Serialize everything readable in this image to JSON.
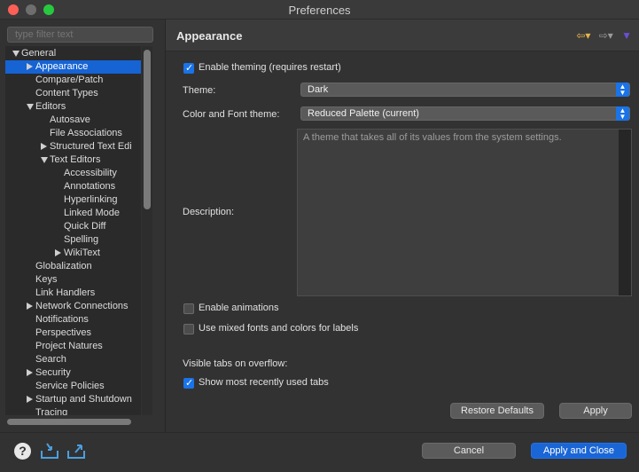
{
  "window": {
    "title": "Preferences"
  },
  "filter": {
    "placeholder": "type filter text"
  },
  "tree": {
    "items": [
      {
        "label": "General",
        "level": 0,
        "expander": "down",
        "selected": false
      },
      {
        "label": "Appearance",
        "level": 1,
        "expander": "right",
        "selected": true
      },
      {
        "label": "Compare/Patch",
        "level": 1,
        "expander": "",
        "selected": false
      },
      {
        "label": "Content Types",
        "level": 1,
        "expander": "",
        "selected": false
      },
      {
        "label": "Editors",
        "level": 1,
        "expander": "down",
        "selected": false
      },
      {
        "label": "Autosave",
        "level": 2,
        "expander": "",
        "selected": false
      },
      {
        "label": "File Associations",
        "level": 2,
        "expander": "",
        "selected": false
      },
      {
        "label": "Structured Text Edi",
        "level": 2,
        "expander": "right",
        "selected": false
      },
      {
        "label": "Text Editors",
        "level": 2,
        "expander": "down",
        "selected": false
      },
      {
        "label": "Accessibility",
        "level": 3,
        "expander": "",
        "selected": false
      },
      {
        "label": "Annotations",
        "level": 3,
        "expander": "",
        "selected": false
      },
      {
        "label": "Hyperlinking",
        "level": 3,
        "expander": "",
        "selected": false
      },
      {
        "label": "Linked Mode",
        "level": 3,
        "expander": "",
        "selected": false
      },
      {
        "label": "Quick Diff",
        "level": 3,
        "expander": "",
        "selected": false
      },
      {
        "label": "Spelling",
        "level": 3,
        "expander": "",
        "selected": false
      },
      {
        "label": "WikiText",
        "level": 3,
        "expander": "right",
        "selected": false
      },
      {
        "label": "Globalization",
        "level": 1,
        "expander": "",
        "selected": false
      },
      {
        "label": "Keys",
        "level": 1,
        "expander": "",
        "selected": false
      },
      {
        "label": "Link Handlers",
        "level": 1,
        "expander": "",
        "selected": false
      },
      {
        "label": "Network Connections",
        "level": 1,
        "expander": "right",
        "selected": false
      },
      {
        "label": "Notifications",
        "level": 1,
        "expander": "",
        "selected": false
      },
      {
        "label": "Perspectives",
        "level": 1,
        "expander": "",
        "selected": false
      },
      {
        "label": "Project Natures",
        "level": 1,
        "expander": "",
        "selected": false
      },
      {
        "label": "Search",
        "level": 1,
        "expander": "",
        "selected": false
      },
      {
        "label": "Security",
        "level": 1,
        "expander": "right",
        "selected": false
      },
      {
        "label": "Service Policies",
        "level": 1,
        "expander": "",
        "selected": false
      },
      {
        "label": "Startup and Shutdown",
        "level": 1,
        "expander": "right",
        "selected": false
      },
      {
        "label": "Tracing",
        "level": 1,
        "expander": "",
        "selected": false
      }
    ]
  },
  "page": {
    "title": "Appearance",
    "enable_theming": {
      "label": "Enable theming (requires restart)",
      "checked": true
    },
    "theme": {
      "label": "Theme:",
      "value": "Dark"
    },
    "color_font_theme": {
      "label": "Color and Font theme:",
      "value": "Reduced Palette (current)"
    },
    "description": {
      "label": "Description:",
      "text": "A theme that takes all of its values from the system settings."
    },
    "enable_animations": {
      "label": "Enable animations",
      "checked": false
    },
    "mixed_fonts": {
      "label": "Use mixed fonts and colors for labels",
      "checked": false
    },
    "visible_tabs": {
      "label": "Visible tabs on overflow:"
    },
    "recent_tabs": {
      "label": "Show most recently used tabs",
      "checked": true
    },
    "restore_defaults": "Restore Defaults",
    "apply": "Apply"
  },
  "footer": {
    "cancel": "Cancel",
    "apply_close": "Apply and Close"
  },
  "colors": {
    "accent": "#1a73e8",
    "selection": "#1663d4",
    "background": "#323232"
  }
}
